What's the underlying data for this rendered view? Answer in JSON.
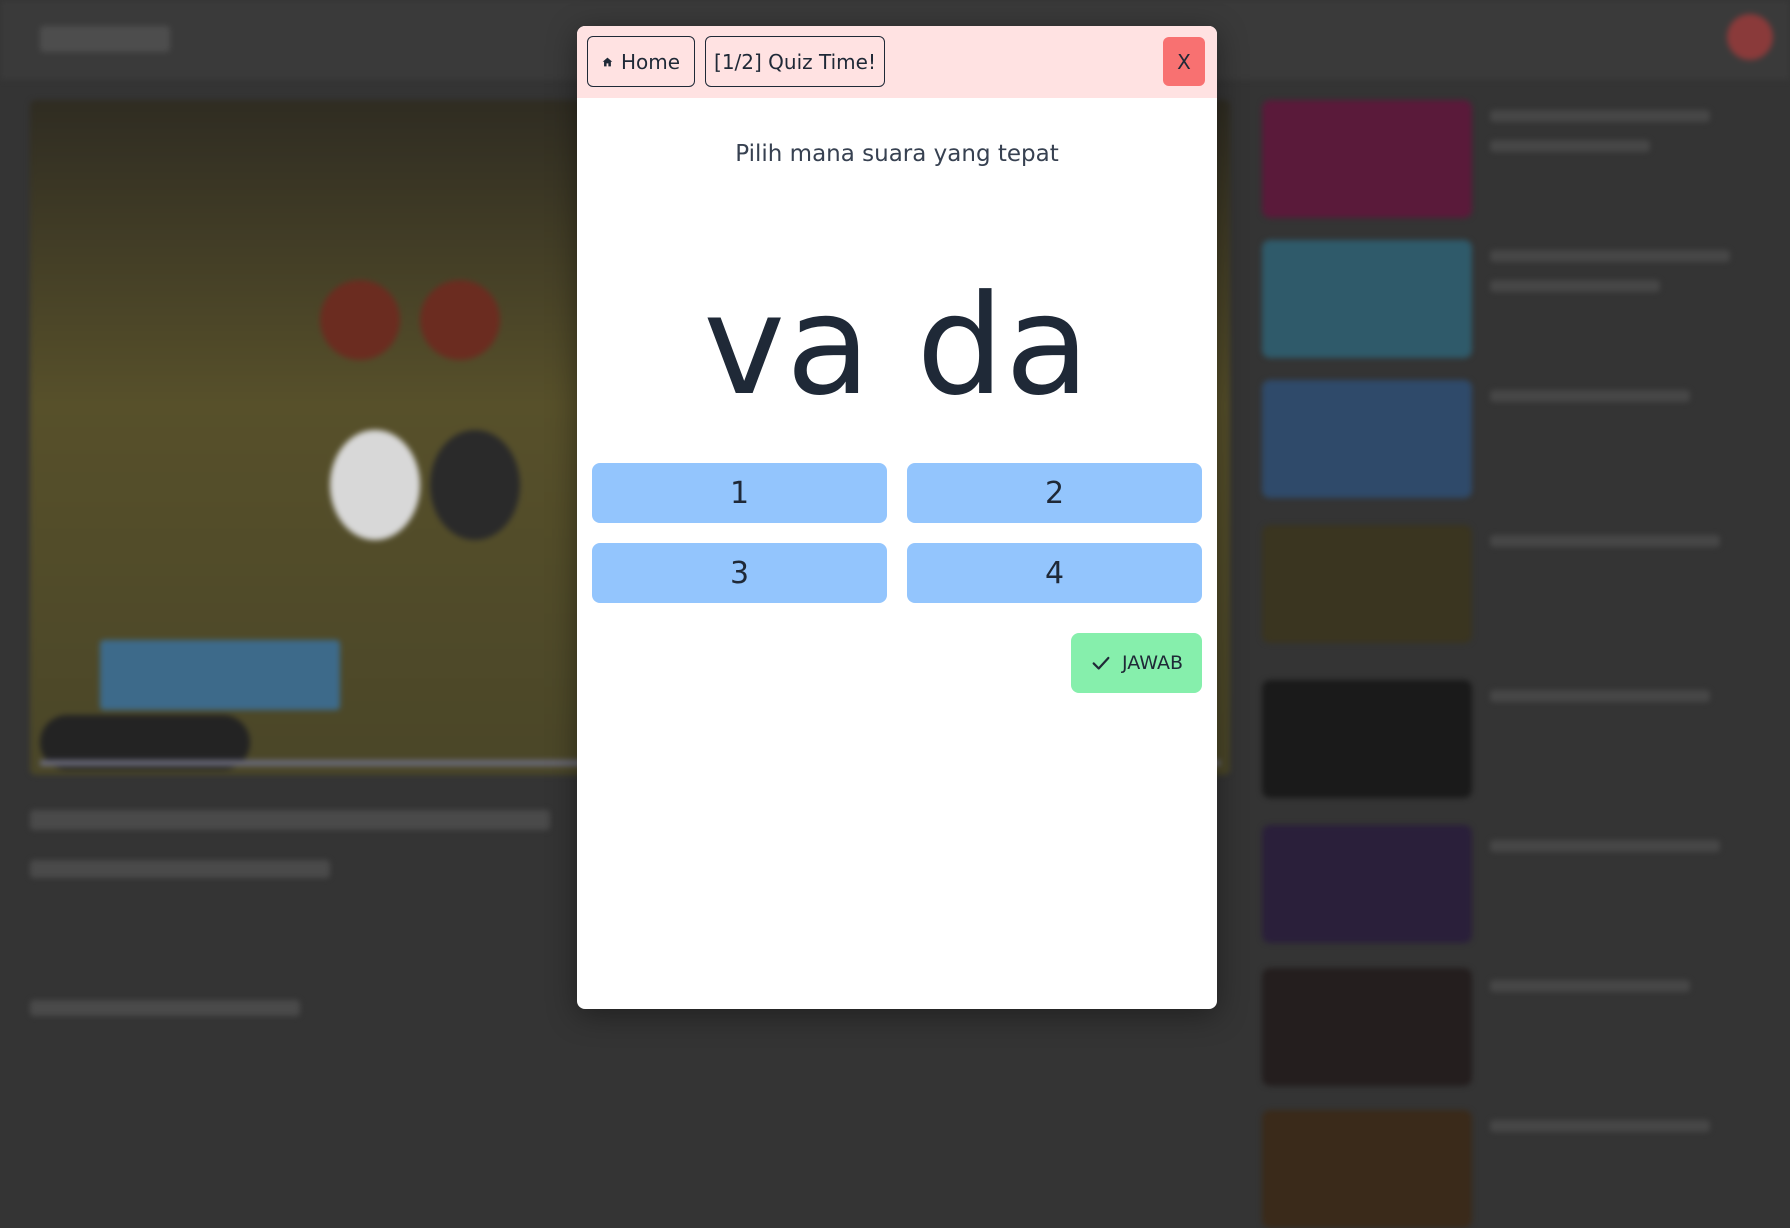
{
  "header": {
    "home_label": "Home",
    "quiz_label": "[1/2] Quiz Time!",
    "close_label": "X",
    "home_icon": "home-icon"
  },
  "quiz": {
    "instruction": "Pilih mana suara yang tepat",
    "word": "va da",
    "options": [
      "1",
      "2",
      "3",
      "4"
    ],
    "answer_label": "JAWAB",
    "answer_icon": "check-icon"
  },
  "colors": {
    "header_bg": "#ffe2e2",
    "close_bg": "#f87171",
    "option_bg": "#93c5fd",
    "answer_bg": "#86efac",
    "text": "#1f2937"
  }
}
